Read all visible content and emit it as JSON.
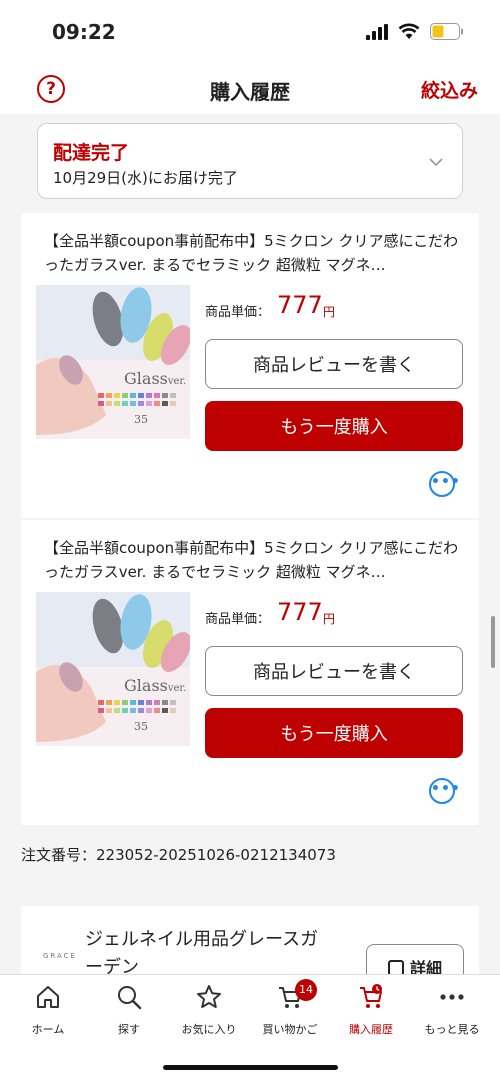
{
  "status_bar": {
    "time": "09:22"
  },
  "header": {
    "help": "?",
    "title": "購入履歴",
    "filter": "絞込み"
  },
  "delivery": {
    "status": "配達完了",
    "detail": "10月29日(水)にお届け完了"
  },
  "items": [
    {
      "name": "【全品半額coupon事前配布中】5ミクロン クリア感にこだわったガラスver. まるでセラミック 超微粒 マグネ…",
      "price_label": "商品単価：",
      "price": "777",
      "currency": "円",
      "review_label": "商品レビューを書く",
      "buy_again_label": "もう一度購入",
      "thumb_text": "Glass",
      "thumb_suffix": "ver.",
      "thumb_count": "35"
    },
    {
      "name": "【全品半額coupon事前配布中】5ミクロン クリア感にこだわったガラスver. まるでセラミック 超微粒 マグネ…",
      "price_label": "商品単価：",
      "price": "777",
      "currency": "円",
      "review_label": "商品レビューを書く",
      "buy_again_label": "もう一度購入",
      "thumb_text": "Glass",
      "thumb_suffix": "ver.",
      "thumb_count": "35"
    }
  ],
  "order": {
    "number": "注文番号：223052-20251026-0212134073"
  },
  "shop": {
    "logo": "GRACE",
    "name": "ジェルネイル用品グレースガーデン",
    "detail_label": "詳細"
  },
  "nav": {
    "home": "ホーム",
    "search": "探す",
    "favorites": "お気に入り",
    "cart": "買い物かご",
    "cart_badge": "14",
    "history": "購入履歴",
    "more": "もっと見る"
  },
  "colors": {
    "accent": "#bf0000",
    "link": "#1e88e5"
  }
}
